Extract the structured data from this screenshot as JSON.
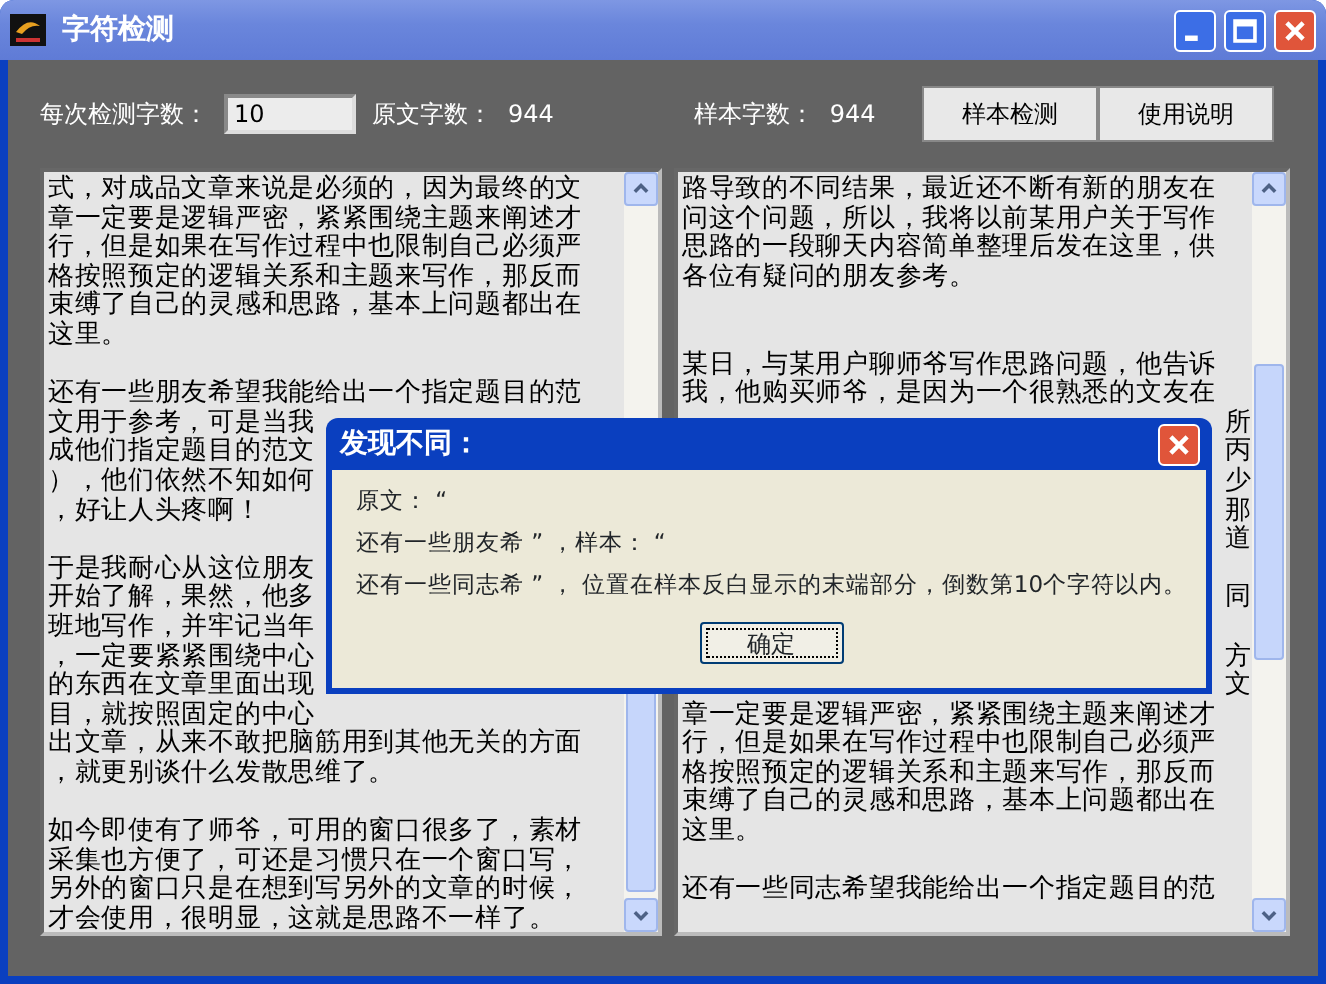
{
  "window": {
    "title": "字符检测"
  },
  "toolbar": {
    "count_label": "每次检测字数：",
    "count_value": "10",
    "original_label": "原文字数：",
    "original_count": "944",
    "sample_label": "样本字数：",
    "sample_count": "944",
    "buttons": [
      "样本检测",
      "使用说明"
    ]
  },
  "original_text": {
    "lines": [
      {
        "kind": "text",
        "text": "式，对成品文章来说是必须的，因为最终的文"
      },
      {
        "kind": "text",
        "text": "章一定要是逻辑严密，紧紧围绕主题来阐述才"
      },
      {
        "kind": "text",
        "text": "行，但是如果在写作过程中也限制自己必须严"
      },
      {
        "kind": "text",
        "text": "格按照预定的逻辑关系和主题来写作，那反而"
      },
      {
        "kind": "text",
        "text": "束缚了自己的灵感和思路，基本上问题都出在"
      },
      {
        "kind": "text",
        "text": "这里。"
      },
      {
        "kind": "blank"
      },
      {
        "kind": "text",
        "text": "还有一些朋友希望我能给出一个指定题目的范"
      },
      {
        "kind": "text",
        "text": "文用于参考，可是当我"
      },
      {
        "kind": "text",
        "text": "成他们指定题目的范文"
      },
      {
        "kind": "text",
        "text": "），他们依然不知如何"
      },
      {
        "kind": "text",
        "text": "，好让人头疼啊！"
      },
      {
        "kind": "blank"
      },
      {
        "kind": "text",
        "text": "于是我耐心从这位朋友"
      },
      {
        "kind": "text",
        "text": "开始了解，果然，他多"
      },
      {
        "kind": "text",
        "text": "班地写作，并牢记当年"
      },
      {
        "kind": "text",
        "text": "，一定要紧紧围绕中心"
      },
      {
        "kind": "text",
        "text": "的东西在文章里面出现"
      },
      {
        "kind": "text",
        "text": "目，就按照固定的中心"
      },
      {
        "kind": "text",
        "text": "出文章，从来不敢把脑筋用到其他无关的方面"
      },
      {
        "kind": "text",
        "text": "，就更别谈什么发散思维了。"
      },
      {
        "kind": "blank"
      },
      {
        "kind": "text",
        "text": "如今即使有了师爷，可用的窗口很多了，素材"
      },
      {
        "kind": "text",
        "text": "采集也方便了，可还是习惯只在一个窗口写，"
      },
      {
        "kind": "text",
        "text": "另外的窗口只是在想到写另外的文章的时候，"
      },
      {
        "kind": "text",
        "text": "才会使用，很明显，这就是思路不一样了。"
      }
    ]
  },
  "sample_text": {
    "lines": [
      {
        "kind": "text",
        "text": "路导致的不同结果，最近还不断有新的朋友在"
      },
      {
        "kind": "text",
        "text": "问这个问题，所以，我将以前某用户关于写作"
      },
      {
        "kind": "text",
        "text": "思路的一段聊天内容简单整理后发在这里，供"
      },
      {
        "kind": "text",
        "text": "各位有疑问的朋友参考。"
      },
      {
        "kind": "blank"
      },
      {
        "kind": "blank"
      },
      {
        "kind": "text",
        "text": "某日，与某用户聊师爷写作思路问题，他告诉"
      },
      {
        "kind": "text",
        "text": "我，他购买师爷，是因为一个很熟悉的文友在"
      },
      {
        "kind": "tail",
        "text": "所"
      },
      {
        "kind": "tail",
        "text": "丙"
      },
      {
        "kind": "tail",
        "text": "少"
      },
      {
        "kind": "tail",
        "text": "那"
      },
      {
        "kind": "tail",
        "text": "道"
      },
      {
        "kind": "blank"
      },
      {
        "kind": "tail",
        "text": "同"
      },
      {
        "kind": "blank"
      },
      {
        "kind": "tail",
        "text": "方"
      },
      {
        "kind": "tail",
        "text": "文"
      },
      {
        "kind": "text",
        "text": "章一定要是逻辑严密，紧紧围绕主题来阐述才"
      },
      {
        "kind": "text",
        "text": "行，但是如果在写作过程中也限制自己必须严"
      },
      {
        "kind": "text",
        "text": "格按照预定的逻辑关系和主题来写作，那反而"
      },
      {
        "kind": "text",
        "text": "束缚了自己的灵感和思路，基本上问题都出在"
      },
      {
        "kind": "text",
        "text": "这里。"
      },
      {
        "kind": "blank"
      },
      {
        "kind": "text",
        "text": "还有一些同志希望我能给出一个指定题目的范"
      }
    ]
  },
  "dialog": {
    "title": "发现不同：",
    "lines": [
      "原文： “",
      "还有一些朋友希 ” ，样本： “",
      "还有一些同志希 ” ， 位置在样本反白显示的末端部分，倒数第10个字符以内。"
    ],
    "button": "确定"
  }
}
